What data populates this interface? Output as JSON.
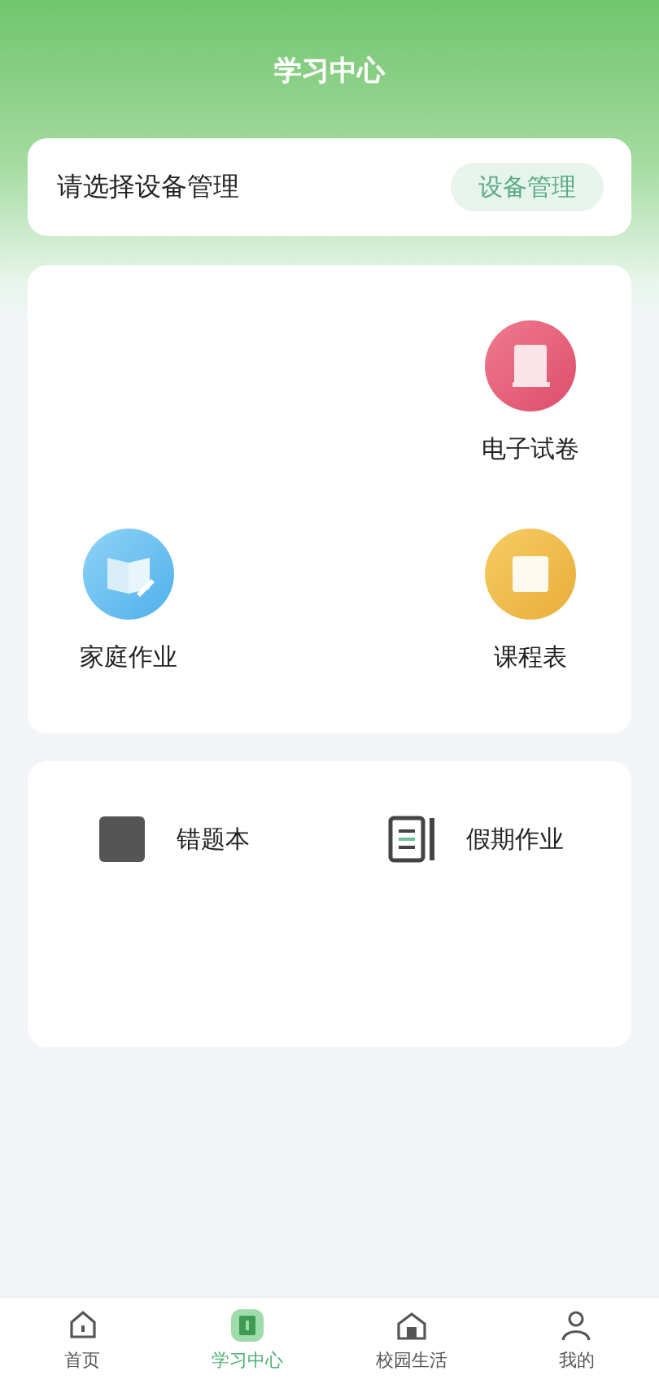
{
  "header": {
    "title": "学习中心"
  },
  "device_bar": {
    "prompt": "请选择设备管理",
    "button": "设备管理"
  },
  "feature_grid": {
    "rows": [
      {
        "cells": [
          {
            "kind": "blank"
          },
          {
            "kind": "blank"
          },
          {
            "kind": "exam",
            "label": "电子试卷"
          }
        ]
      },
      {
        "cells": [
          {
            "kind": "homework",
            "label": "家庭作业"
          },
          {
            "kind": "blank"
          },
          {
            "kind": "schedule",
            "label": "课程表"
          }
        ]
      }
    ]
  },
  "tools": [
    {
      "kind": "mistakes",
      "label": "错题本"
    },
    {
      "kind": "holiday",
      "label": "假期作业"
    }
  ],
  "tab_bar": [
    {
      "kind": "home",
      "label": "首页",
      "selected": false
    },
    {
      "kind": "study",
      "label": "学习中心",
      "selected": true
    },
    {
      "kind": "campus",
      "label": "校园生活",
      "selected": false
    },
    {
      "kind": "me",
      "label": "我的",
      "selected": false
    }
  ]
}
